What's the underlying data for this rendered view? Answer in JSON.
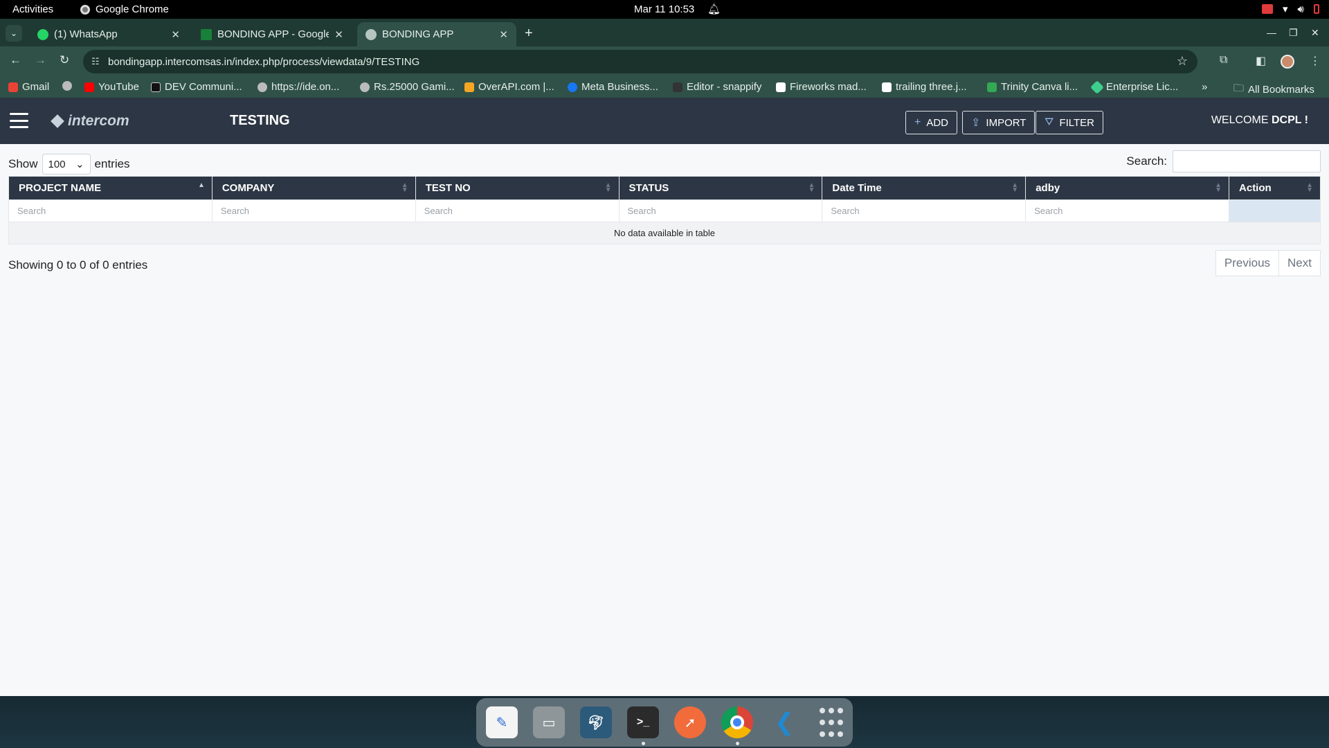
{
  "system": {
    "activities": "Activities",
    "app_name": "Google Chrome",
    "clock": "Mar 11  10:53"
  },
  "tabs": [
    {
      "title": "(1) WhatsApp",
      "icon": "whatsapp-icon"
    },
    {
      "title": "BONDING APP - Google S",
      "icon": "sheets-icon"
    },
    {
      "title": "BONDING APP",
      "icon": "globe-icon",
      "active": true
    }
  ],
  "toolbar": {
    "url": "bondingapp.intercomsas.in/index.php/process/viewdata/9/TESTING"
  },
  "bookmarks": [
    {
      "label": "Gmail",
      "color": "#ea4335"
    },
    {
      "label": "",
      "color": "#bbbbbb"
    },
    {
      "label": "YouTube",
      "color": "#ff0000"
    },
    {
      "label": "DEV Communi...",
      "color": "#111111"
    },
    {
      "label": "https://ide.on...",
      "color": "#bbbbbb"
    },
    {
      "label": "Rs.25000 Gami...",
      "color": "#bbbbbb"
    },
    {
      "label": "OverAPI.com |...",
      "color": "#f5a623"
    },
    {
      "label": "Meta Business...",
      "color": "#1877f2"
    },
    {
      "label": "Editor - snappify",
      "color": "#333333"
    },
    {
      "label": "Fireworks mad...",
      "color": "#ffffff"
    },
    {
      "label": "trailing three.j...",
      "color": "#ffffff"
    },
    {
      "label": "Trinity Canva li...",
      "color": "#34a853"
    },
    {
      "label": "Enterprise Lic...",
      "color": "#3ecf8e"
    }
  ],
  "all_bookmarks": "All Bookmarks",
  "app": {
    "logo": "intercom",
    "page_title": "TESTING",
    "buttons": {
      "add": "ADD",
      "import": "IMPORT",
      "filter": "FILTER"
    },
    "welcome_prefix": "WELCOME ",
    "welcome_user": "DCPL !"
  },
  "table": {
    "show_label": "Show",
    "entries_label": "entries",
    "page_length": "100",
    "search_label": "Search:",
    "filter_placeholder": "Search",
    "columns": [
      "PROJECT NAME",
      "COMPANY",
      "TEST NO",
      "STATUS",
      "Date Time",
      "adby",
      "Action"
    ],
    "empty_message": "No data available in table",
    "info": "Showing 0 to 0 of 0 entries",
    "prev": "Previous",
    "next": "Next"
  },
  "colors": {
    "header_bg": "#2d3644",
    "tabstrip_bg": "#1f3a33",
    "toolbar_bg": "#2f5148"
  }
}
